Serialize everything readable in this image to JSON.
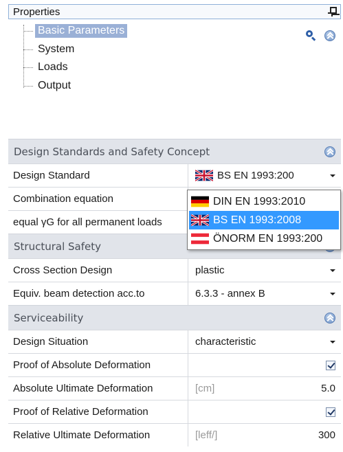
{
  "panel": {
    "title": "Properties"
  },
  "tree": {
    "items": [
      {
        "label": "Basic Parameters",
        "selected": true
      },
      {
        "label": "System",
        "selected": false
      },
      {
        "label": "Loads",
        "selected": false
      },
      {
        "label": "Output",
        "selected": false
      }
    ]
  },
  "sections": {
    "design": {
      "title": "Design Standards and Safety Concept",
      "rows": {
        "design_standard": {
          "name": "Design Standard",
          "value": "BS EN 1993:200"
        },
        "combination": {
          "name": "Combination equation"
        },
        "equal_yg": {
          "name": "equal γG for all permanent loads"
        }
      }
    },
    "structural": {
      "title": "Structural Safety",
      "rows": {
        "cross_section": {
          "name": "Cross Section Design",
          "value": "plastic"
        },
        "equiv_beam": {
          "name": "Equiv. beam detection acc.to",
          "value": "6.3.3 - annex B"
        }
      }
    },
    "serviceability": {
      "title": "Serviceability",
      "rows": {
        "design_situation": {
          "name": "Design Situation",
          "value": "characteristic"
        },
        "proof_abs": {
          "name": "Proof of Absolute Deformation",
          "checked": true
        },
        "abs_ult": {
          "name": "Absolute Ultimate Deformation",
          "unit": "[cm]",
          "value": "5.0"
        },
        "proof_rel": {
          "name": "Proof of Relative Deformation",
          "checked": true
        },
        "rel_ult": {
          "name": "Relative Ultimate Deformation",
          "unit": "[leff/]",
          "value": "300"
        }
      }
    }
  },
  "dropdown": {
    "options": [
      {
        "label": "DIN EN 1993:2010",
        "flag": "germany-flag",
        "selected": false
      },
      {
        "label": "BS EN 1993:2008",
        "flag": "uk-flag",
        "selected": true
      },
      {
        "label": "ÖNORM EN 1993:200",
        "flag": "austria-flag",
        "selected": false
      }
    ]
  },
  "colors": {
    "selection": "#3399ff",
    "tree_selection": "#9ab0d6",
    "section_bg": "#e1e4ea",
    "header_border": "#8fb0d8"
  }
}
